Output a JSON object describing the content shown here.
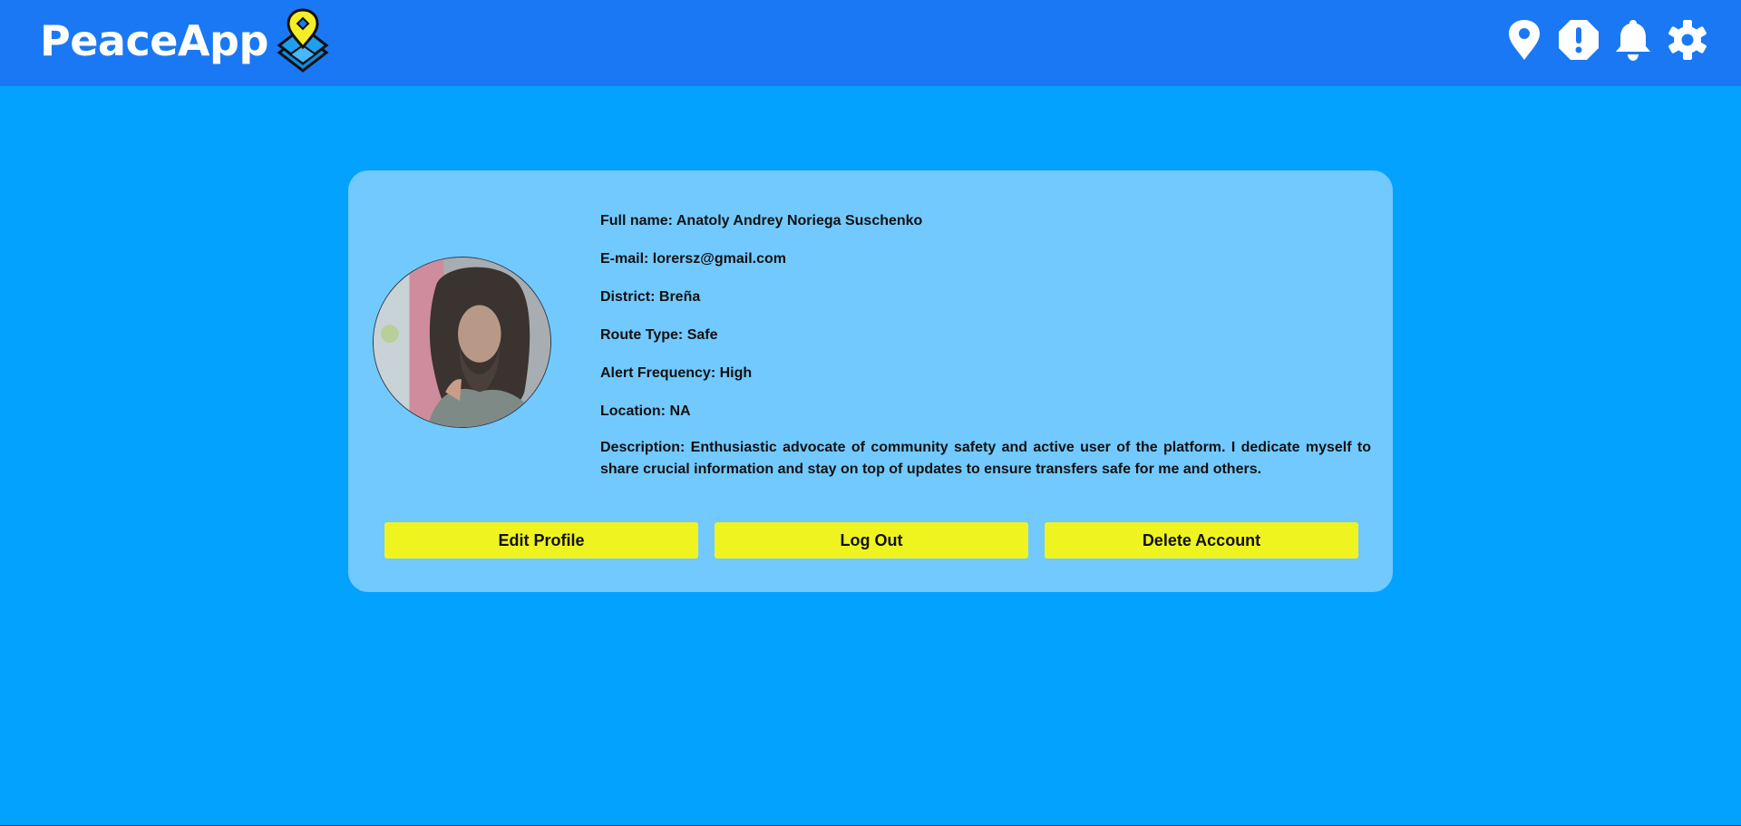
{
  "app": {
    "name": "PeaceApp"
  },
  "nav": [
    {
      "id": "location",
      "icon": "location-pin-icon"
    },
    {
      "id": "alerts",
      "icon": "alert-octagon-icon"
    },
    {
      "id": "notifications",
      "icon": "bell-icon"
    },
    {
      "id": "settings",
      "icon": "gear-icon"
    }
  ],
  "profile": {
    "full_name": "Full name: Anatoly Andrey Noriega Suschenko",
    "email": "E-mail: lorersz@gmail.com",
    "district": "District: Breña",
    "route_type": "Route Type: Safe",
    "alert_frequency": "Alert Frequency: High",
    "location": "Location: NA",
    "description": "Description: Enthusiastic advocate of community safety and active user of the platform. I dedicate myself to share crucial information and stay on top of updates to ensure transfers safe for me and others."
  },
  "actions": {
    "edit": "Edit Profile",
    "logout": "Log Out",
    "delete": "Delete Account"
  },
  "colors": {
    "topbar": "#1b78f4",
    "background": "#03a2fe",
    "card": "#72c9fe",
    "button": "#eff420"
  }
}
